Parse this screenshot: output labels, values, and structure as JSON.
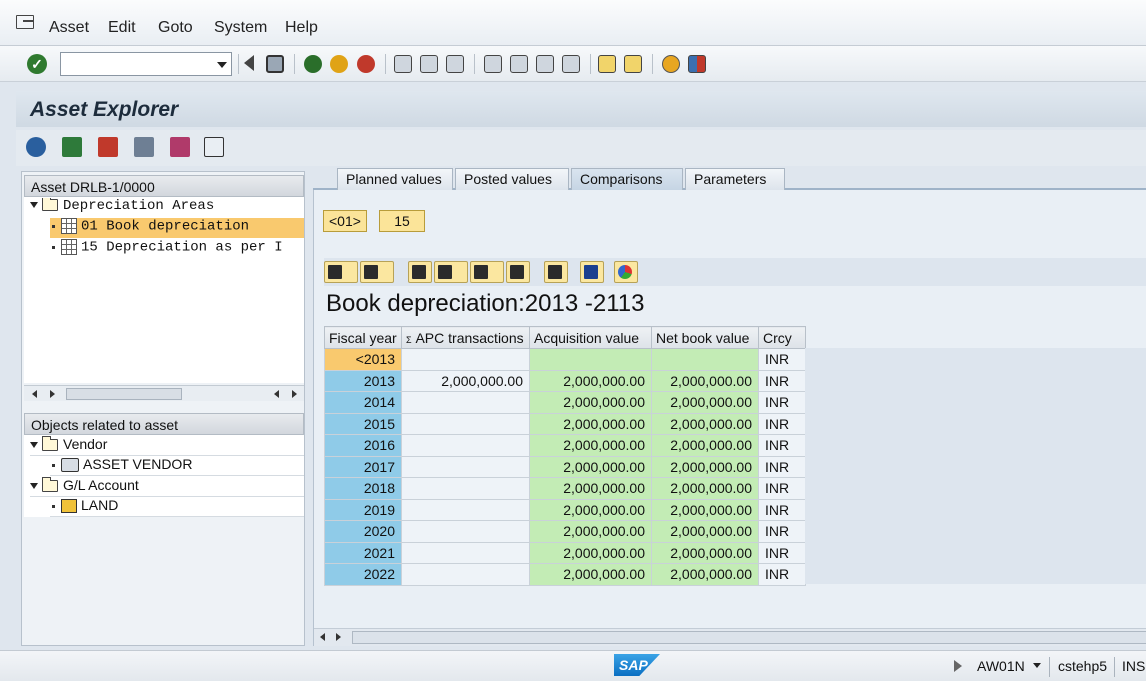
{
  "menu": {
    "items": [
      {
        "label": "Asset"
      },
      {
        "label": "Edit"
      },
      {
        "label": "Goto"
      },
      {
        "label": "System"
      },
      {
        "label": "Help"
      }
    ]
  },
  "toolbar": {
    "command_field_value": "",
    "icons": [
      "enter-icon",
      "back-icon",
      "save-icon",
      "exit-icon",
      "cancel-icon",
      "print-icon",
      "find-icon",
      "find-next-icon",
      "first-page-icon",
      "previous-page-icon",
      "next-page-icon",
      "last-page-icon",
      "create-session-icon",
      "shortcut-icon",
      "help-icon",
      "layout-icon"
    ]
  },
  "page": {
    "title": "Asset Explorer"
  },
  "tree": {
    "header": "Asset DRLB-1/0000",
    "root": "Depreciation Areas",
    "items": [
      {
        "label": "01 Book depreciation",
        "selected": true
      },
      {
        "label": "15 Depreciation as per I",
        "selected": false
      }
    ]
  },
  "related": {
    "header": "Objects related to asset",
    "groups": [
      {
        "label": "Vendor",
        "child": "ASSET VENDOR"
      },
      {
        "label": "G/L Account",
        "child": "LAND"
      }
    ]
  },
  "tabs": [
    {
      "label": "Planned values",
      "active": false
    },
    {
      "label": "Posted values",
      "active": false
    },
    {
      "label": "Comparisons",
      "active": true
    },
    {
      "label": "Parameters",
      "active": false
    }
  ],
  "area_buttons": {
    "first": "<01>",
    "second": "15"
  },
  "report": {
    "title": "Book depreciation:2013 -2113",
    "columns": [
      "Fiscal year",
      "APC transactions",
      "Acquisition value",
      "Net book value",
      "Crcy"
    ],
    "sum_marker": "Σ",
    "rows": [
      {
        "year": "<2013",
        "apc": "",
        "acq": "",
        "nbv": "",
        "crcy": "INR"
      },
      {
        "year": "2013",
        "apc": "2,000,000.00",
        "acq": "2,000,000.00",
        "nbv": "2,000,000.00",
        "crcy": "INR"
      },
      {
        "year": "2014",
        "apc": "",
        "acq": "2,000,000.00",
        "nbv": "2,000,000.00",
        "crcy": "INR"
      },
      {
        "year": "2015",
        "apc": "",
        "acq": "2,000,000.00",
        "nbv": "2,000,000.00",
        "crcy": "INR"
      },
      {
        "year": "2016",
        "apc": "",
        "acq": "2,000,000.00",
        "nbv": "2,000,000.00",
        "crcy": "INR"
      },
      {
        "year": "2017",
        "apc": "",
        "acq": "2,000,000.00",
        "nbv": "2,000,000.00",
        "crcy": "INR"
      },
      {
        "year": "2018",
        "apc": "",
        "acq": "2,000,000.00",
        "nbv": "2,000,000.00",
        "crcy": "INR"
      },
      {
        "year": "2019",
        "apc": "",
        "acq": "2,000,000.00",
        "nbv": "2,000,000.00",
        "crcy": "INR"
      },
      {
        "year": "2020",
        "apc": "",
        "acq": "2,000,000.00",
        "nbv": "2,000,000.00",
        "crcy": "INR"
      },
      {
        "year": "2021",
        "apc": "",
        "acq": "2,000,000.00",
        "nbv": "2,000,000.00",
        "crcy": "INR"
      },
      {
        "year": "2022",
        "apc": "",
        "acq": "2,000,000.00",
        "nbv": "2,000,000.00",
        "crcy": "INR"
      }
    ]
  },
  "status": {
    "logo": "SAP",
    "transaction": "AW01N",
    "server": "cstehp5",
    "mode": "INS"
  },
  "colors": {
    "year_cell": "#8fcbe8",
    "value_cell": "#c3ecb5",
    "selected": "#f9c96e",
    "button_yellow": "#fbe499"
  }
}
